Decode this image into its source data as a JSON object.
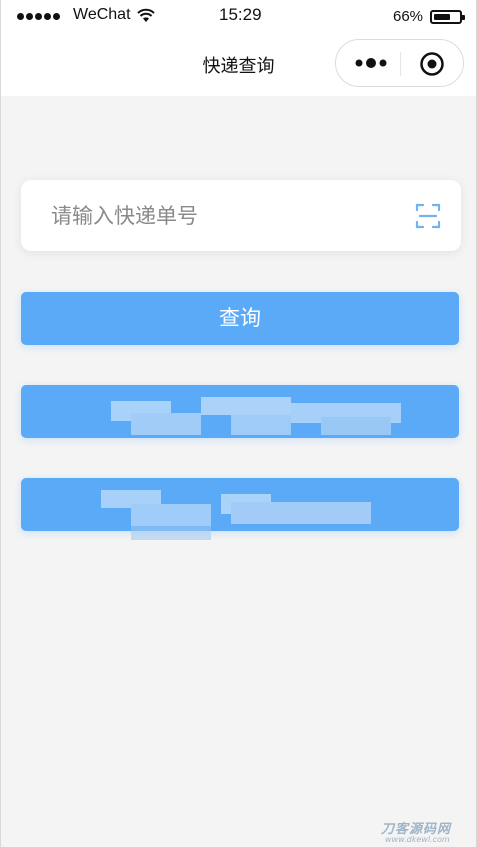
{
  "status_bar": {
    "carrier": "WeChat",
    "time": "15:29",
    "battery_percent": "66%",
    "battery_level": 0.66
  },
  "nav": {
    "title": "快递查询"
  },
  "search": {
    "value": "",
    "placeholder": "请输入快递单号"
  },
  "buttons": {
    "query_label": "查询"
  },
  "colors": {
    "accent": "#5aaaf8",
    "page_background": "#f4f4f4",
    "nav_background": "#ffffff"
  },
  "icons": {
    "more": "more-dots-icon",
    "close_miniprogram": "target-circle-icon",
    "scan": "scan-icon",
    "wifi": "wifi-icon",
    "battery": "battery-icon"
  },
  "watermark": {
    "text": "刀客源码网",
    "url_text": "www.dkewl.com"
  }
}
